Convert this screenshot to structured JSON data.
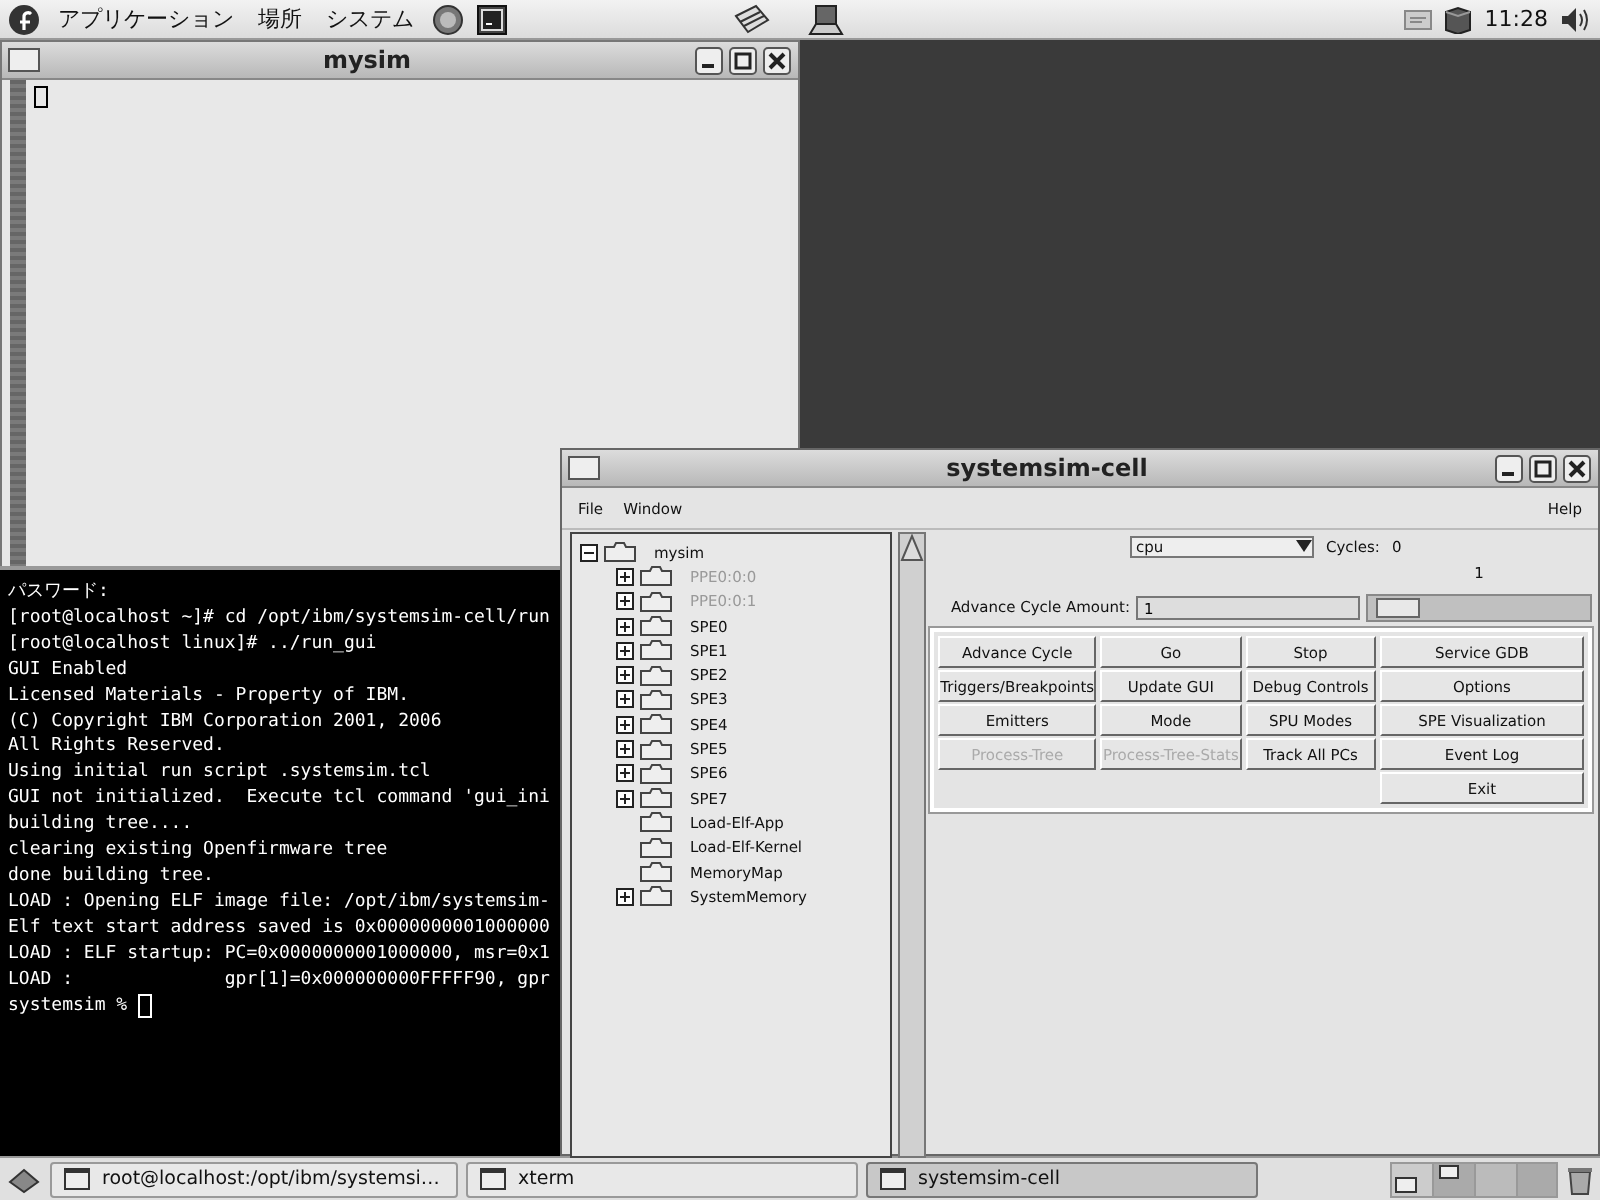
{
  "top_panel": {
    "menus": [
      "アプリケーション",
      "場所",
      "システム"
    ],
    "clock": "11:28"
  },
  "mysim_window": {
    "title": "mysim"
  },
  "terminal": {
    "lines": [
      "パスワード:",
      "[root@localhost ~]# cd /opt/ibm/systemsim-cell/run",
      "[root@localhost linux]# ../run_gui",
      "GUI Enabled",
      "Licensed Materials - Property of IBM.",
      "(C) Copyright IBM Corporation 2001, 2006",
      "All Rights Reserved.",
      "Using initial run script .systemsim.tcl",
      "GUI not initialized.  Execute tcl command 'gui_ini",
      "building tree....",
      "clearing existing Openfirmware tree",
      "done building tree.",
      "LOAD : Opening ELF image file: /opt/ibm/systemsim-",
      "Elf text start address saved is 0x0000000001000000",
      "LOAD : ELF startup: PC=0x0000000001000000, msr=0x1",
      "LOAD :              gpr[1]=0x000000000FFFFF90, gpr"
    ],
    "prompt": "systemsim %"
  },
  "cell_window": {
    "title": "systemsim-cell",
    "menus": [
      "File",
      "Window"
    ],
    "help": "Help",
    "tree": {
      "label": "mysim",
      "kind": "group",
      "expanded": true,
      "disabled": false,
      "children": [
        {
          "label": "PPE0:0:0",
          "kind": "group",
          "expanded": false,
          "disabled": true
        },
        {
          "label": "PPE0:0:1",
          "kind": "group",
          "expanded": false,
          "disabled": true
        },
        {
          "label": "SPE0",
          "kind": "group",
          "expanded": false,
          "disabled": false
        },
        {
          "label": "SPE1",
          "kind": "group",
          "expanded": false,
          "disabled": false
        },
        {
          "label": "SPE2",
          "kind": "group",
          "expanded": false,
          "disabled": false
        },
        {
          "label": "SPE3",
          "kind": "group",
          "expanded": false,
          "disabled": false
        },
        {
          "label": "SPE4",
          "kind": "group",
          "expanded": false,
          "disabled": false
        },
        {
          "label": "SPE5",
          "kind": "group",
          "expanded": false,
          "disabled": false
        },
        {
          "label": "SPE6",
          "kind": "group",
          "expanded": false,
          "disabled": false
        },
        {
          "label": "SPE7",
          "kind": "group",
          "expanded": false,
          "disabled": false
        },
        {
          "label": "Load-Elf-App",
          "kind": "leaf",
          "disabled": false
        },
        {
          "label": "Load-Elf-Kernel",
          "kind": "leaf",
          "disabled": false
        },
        {
          "label": "MemoryMap",
          "kind": "leaf",
          "disabled": false
        },
        {
          "label": "SystemMemory",
          "kind": "group",
          "expanded": false,
          "disabled": false
        }
      ]
    },
    "cpu_select": {
      "value": "cpu"
    },
    "cycles_label": "Cycles:",
    "cycles_value": "0",
    "advance_label": "Advance Cycle Amount:",
    "advance_value": "1",
    "slider": {
      "reading": "1",
      "level": 0.05
    },
    "button_rows": [
      [
        {
          "label": "Advance Cycle",
          "disabled": false
        },
        {
          "label": "Go",
          "disabled": false
        },
        {
          "label": "Stop",
          "disabled": false
        },
        {
          "label": "Service GDB",
          "disabled": false
        }
      ],
      [
        {
          "label": "Triggers/Breakpoints",
          "disabled": false
        },
        {
          "label": "Update GUI",
          "disabled": false
        },
        {
          "label": "Debug Controls",
          "disabled": false
        },
        {
          "label": "Options",
          "disabled": false
        }
      ],
      [
        {
          "label": "Emitters",
          "disabled": false
        },
        {
          "label": "Mode",
          "disabled": false
        },
        {
          "label": "SPU Modes",
          "disabled": false
        },
        {
          "label": "SPE Visualization",
          "disabled": false
        }
      ],
      [
        {
          "label": "Process-Tree",
          "disabled": true
        },
        {
          "label": "Process-Tree-Stats",
          "disabled": true
        },
        {
          "label": "Track All PCs",
          "disabled": false
        },
        {
          "label": "Event Log",
          "disabled": false
        }
      ],
      [
        {
          "label": "Exit",
          "disabled": false
        }
      ]
    ]
  },
  "taskbar": {
    "items": [
      {
        "label": "root@localhost:/opt/ibm/systemsi…",
        "selected": false
      },
      {
        "label": "xterm",
        "selected": false
      },
      {
        "label": "systemsim-cell",
        "selected": true
      }
    ]
  }
}
